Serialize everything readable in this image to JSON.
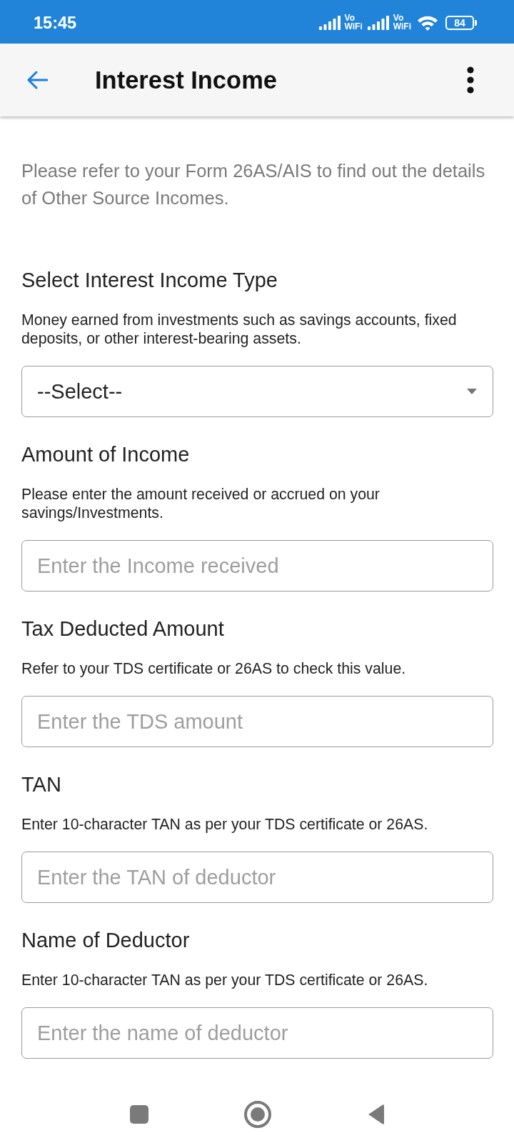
{
  "status_bar": {
    "time": "15:45",
    "network_badges": [
      {
        "top": "Vo",
        "bottom": "WiFi"
      },
      {
        "top": "Vo",
        "bottom": "WiFi"
      }
    ],
    "battery": "84"
  },
  "app_bar": {
    "title": "Interest Income"
  },
  "intro": "Please refer to your Form 26AS/AIS to find out the details of Other Source Incomes.",
  "fields": [
    {
      "kind": "select",
      "label": "Select Interest Income Type",
      "hint": "Money earned from investments such as savings accounts, fixed deposits, or other interest-bearing assets.",
      "value": "--Select--"
    },
    {
      "kind": "text",
      "label": "Amount of Income",
      "hint": "Please enter the amount received or accrued on your savings/Investments.",
      "placeholder": "Enter the Income received"
    },
    {
      "kind": "text",
      "label": "Tax Deducted Amount",
      "hint": "Refer to your TDS certificate or 26AS to check this value.",
      "placeholder": "Enter the TDS amount"
    },
    {
      "kind": "text",
      "label": "TAN",
      "hint": "Enter 10-character TAN as per your TDS certificate or 26AS.",
      "placeholder": "Enter the TAN of deductor"
    },
    {
      "kind": "text",
      "label": "Name of Deductor",
      "hint": "Enter 10-character TAN as per your TDS certificate or 26AS.",
      "placeholder": "Enter the name of deductor"
    }
  ]
}
